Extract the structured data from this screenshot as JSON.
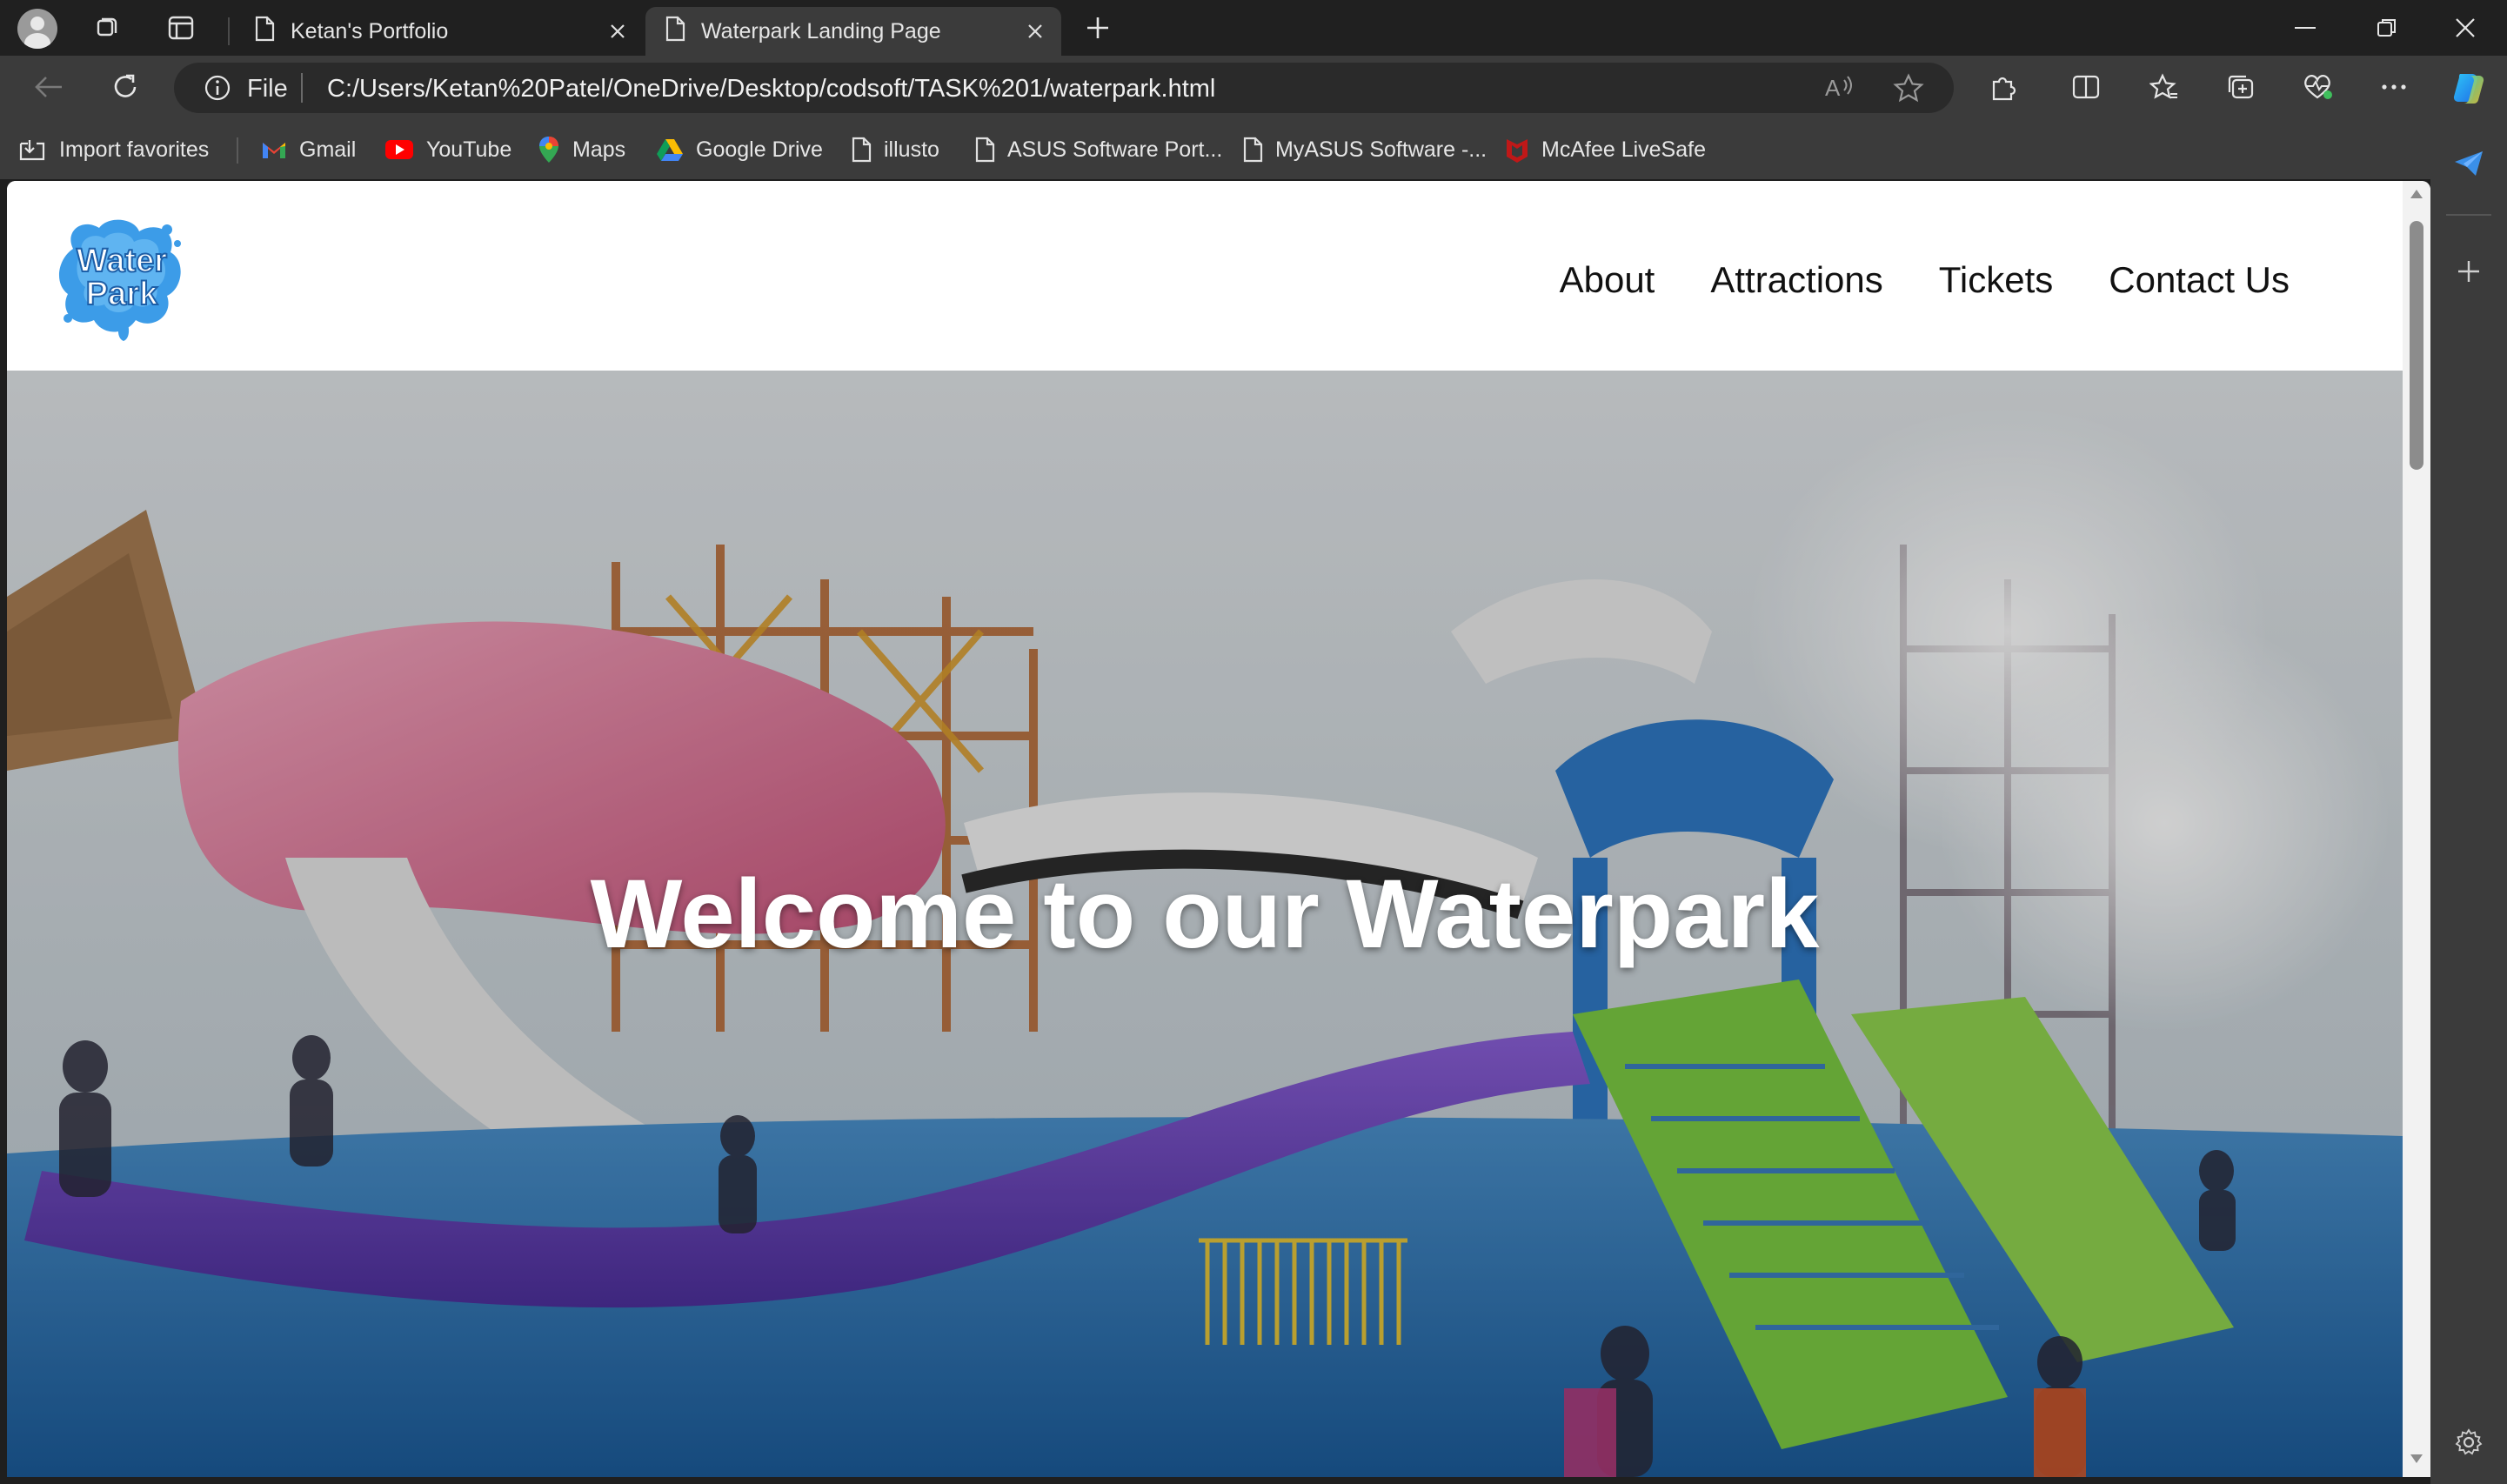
{
  "browser": {
    "tabs": [
      {
        "title": "Ketan's Portfolio",
        "active": false
      },
      {
        "title": "Waterpark Landing Page",
        "active": true
      }
    ],
    "address": {
      "scheme_label": "File",
      "url": "C:/Users/Ketan%20Patel/OneDrive/Desktop/codsoft/TASK%201/waterpark.html"
    },
    "favorites": [
      {
        "label": "Import favorites",
        "icon": "import-icon"
      },
      {
        "label": "Gmail",
        "icon": "gmail-icon"
      },
      {
        "label": "YouTube",
        "icon": "youtube-icon"
      },
      {
        "label": "Maps",
        "icon": "maps-icon"
      },
      {
        "label": "Google Drive",
        "icon": "google-drive-icon"
      },
      {
        "label": "illusto",
        "icon": "page-icon"
      },
      {
        "label": "ASUS Software Port...",
        "icon": "page-icon"
      },
      {
        "label": "MyASUS Software -...",
        "icon": "page-icon"
      },
      {
        "label": "McAfee LiveSafe",
        "icon": "mcafee-icon"
      }
    ]
  },
  "site": {
    "logo": {
      "line1": "Water",
      "line2": "Park"
    },
    "nav": [
      "About",
      "Attractions",
      "Tickets",
      "Contact Us"
    ],
    "hero_title": "Welcome to our Waterpark"
  },
  "colors": {
    "chrome_dark": "#202020",
    "chrome_mid": "#3b3b3b",
    "logo_blue": "#2f8fe0",
    "hero_text": "#ffffff"
  }
}
